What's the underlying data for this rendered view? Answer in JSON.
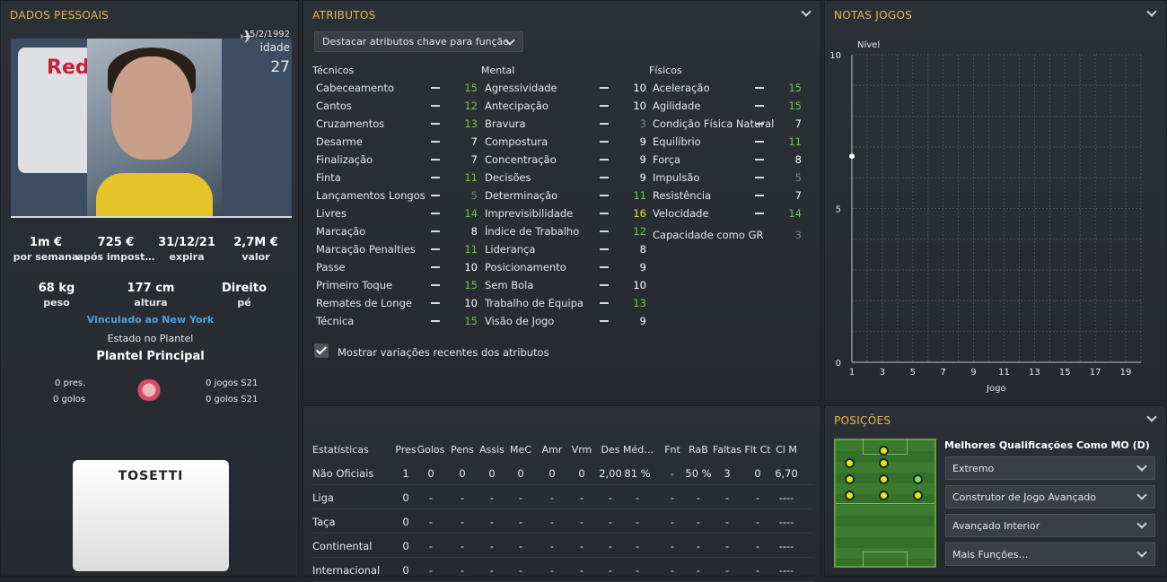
{
  "personal": {
    "title": "DADOS PESSOAIS",
    "dob": "15/2/1992",
    "age_label": "idade",
    "age": "27",
    "club_logo_text": "Red",
    "stats1": [
      {
        "value": "1m €",
        "label": "por semana"
      },
      {
        "value": "725 €",
        "label": "após impost…"
      },
      {
        "value": "31/12/21",
        "label": "expira"
      },
      {
        "value": "2,7M €",
        "label": "valor"
      }
    ],
    "stats2": [
      {
        "value": "68 kg",
        "label": "peso"
      },
      {
        "value": "177 cm",
        "label": "altura"
      },
      {
        "value": "Direito",
        "label": "pé"
      }
    ],
    "contract_link": "Vinculado ao New York",
    "squad_status_label": "Estado no Plantel",
    "squad_status": "Plantel Principal",
    "apps": "0 pres.",
    "goals": "0 golos",
    "apps_season": "0 jogos S21",
    "goals_season": "0 golos S21",
    "shirt_name": "TOSETTI"
  },
  "attributes": {
    "title": "ATRIBUTOS",
    "highlight_dropdown": "Destacar atributos chave para função",
    "technical_header": "Técnicos",
    "mental_header": "Mental",
    "physical_header": "Físicos",
    "technical": [
      {
        "name": "Cabeceamento",
        "value": "15",
        "c": "green"
      },
      {
        "name": "Cantos",
        "value": "12",
        "c": "green"
      },
      {
        "name": "Cruzamentos",
        "value": "13",
        "c": "green"
      },
      {
        "name": "Desarme",
        "value": "7",
        "c": "white"
      },
      {
        "name": "Finalização",
        "value": "7",
        "c": "white"
      },
      {
        "name": "Finta",
        "value": "11",
        "c": "green"
      },
      {
        "name": "Lançamentos Longos",
        "value": "5",
        "c": "gray"
      },
      {
        "name": "Livres",
        "value": "14",
        "c": "green"
      },
      {
        "name": "Marcação",
        "value": "8",
        "c": "white"
      },
      {
        "name": "Marcação Penalties",
        "value": "11",
        "c": "green"
      },
      {
        "name": "Passe",
        "value": "10",
        "c": "white"
      },
      {
        "name": "Primeiro Toque",
        "value": "15",
        "c": "green"
      },
      {
        "name": "Remates de Longe",
        "value": "10",
        "c": "white"
      },
      {
        "name": "Técnica",
        "value": "15",
        "c": "green"
      }
    ],
    "mental": [
      {
        "name": "Agressividade",
        "value": "10",
        "c": "white"
      },
      {
        "name": "Antecipação",
        "value": "10",
        "c": "white"
      },
      {
        "name": "Bravura",
        "value": "3",
        "c": "gray"
      },
      {
        "name": "Compostura",
        "value": "9",
        "c": "white"
      },
      {
        "name": "Concentração",
        "value": "9",
        "c": "white"
      },
      {
        "name": "Decisões",
        "value": "9",
        "c": "white"
      },
      {
        "name": "Determinação",
        "value": "11",
        "c": "green"
      },
      {
        "name": "Imprevisibilidade",
        "value": "16",
        "c": "yellow"
      },
      {
        "name": "Índice de Trabalho",
        "value": "12",
        "c": "green"
      },
      {
        "name": "Liderança",
        "value": "8",
        "c": "white"
      },
      {
        "name": "Posicionamento",
        "value": "9",
        "c": "white"
      },
      {
        "name": "Sem Bola",
        "value": "10",
        "c": "white"
      },
      {
        "name": "Trabalho de Equipa",
        "value": "13",
        "c": "green"
      },
      {
        "name": "Visão de Jogo",
        "value": "9",
        "c": "white"
      }
    ],
    "physical": [
      {
        "name": "Aceleração",
        "value": "15",
        "c": "green"
      },
      {
        "name": "Agilidade",
        "value": "15",
        "c": "green"
      },
      {
        "name": "Condição Física Natural",
        "value": "7",
        "c": "white"
      },
      {
        "name": "Equilíbrio",
        "value": "11",
        "c": "green"
      },
      {
        "name": "Força",
        "value": "8",
        "c": "white"
      },
      {
        "name": "Impulsão",
        "value": "5",
        "c": "gray"
      },
      {
        "name": "Resistência",
        "value": "7",
        "c": "white"
      },
      {
        "name": "Velocidade",
        "value": "14",
        "c": "green"
      }
    ],
    "gk_label": "Capacidade como GR",
    "gk_value": "3",
    "show_changes_label": "Mostrar variações recentes dos atributos"
  },
  "notas": {
    "title": "NOTAS JOGOS",
    "y_label": "Nível",
    "x_label": "Jogo",
    "y_ticks": [
      "10",
      "5",
      "0"
    ],
    "x_ticks": [
      "1",
      "3",
      "5",
      "7",
      "9",
      "11",
      "13",
      "15",
      "17",
      "19"
    ]
  },
  "chart_data": {
    "type": "line",
    "title": "NOTAS JOGOS",
    "xlabel": "Jogo",
    "ylabel": "Nível",
    "ylim": [
      0,
      10
    ],
    "xlim": [
      1,
      20
    ],
    "series": [
      {
        "x": [
          1
        ],
        "values": [
          6.7
        ]
      }
    ]
  },
  "stats": {
    "headers": [
      "Estatísticas",
      "Pres",
      "Golos",
      "Pens",
      "Assis",
      "MeC",
      "Amr",
      "Vrm",
      "Des",
      "Méd…",
      "Fnt",
      "RaB",
      "Faltas",
      "Flt Ct",
      "Cl M"
    ],
    "rows": [
      {
        "label": "Não Oficiais",
        "cells": [
          "1",
          "0",
          "0",
          "0",
          "0",
          "0",
          "0",
          "2,00",
          "81 %",
          "-",
          "50 %",
          "3",
          "0",
          "6,70"
        ]
      },
      {
        "label": "Liga",
        "cells": [
          "0",
          "-",
          "-",
          "-",
          "-",
          "-",
          "-",
          "-",
          "-",
          "-",
          "-",
          "-",
          "-",
          "----"
        ]
      },
      {
        "label": "Taça",
        "cells": [
          "0",
          "-",
          "-",
          "-",
          "-",
          "-",
          "-",
          "-",
          "-",
          "-",
          "-",
          "-",
          "-",
          "----"
        ]
      },
      {
        "label": "Continental",
        "cells": [
          "0",
          "-",
          "-",
          "-",
          "-",
          "-",
          "-",
          "-",
          "-",
          "-",
          "-",
          "-",
          "-",
          "----"
        ]
      },
      {
        "label": "Internacional",
        "cells": [
          "0",
          "-",
          "-",
          "-",
          "-",
          "-",
          "-",
          "-",
          "-",
          "-",
          "-",
          "-",
          "-",
          "----"
        ]
      }
    ]
  },
  "positions": {
    "title": "POSIÇÕES",
    "best_label": "Melhores Qualificações Como MO (D)",
    "roles": [
      "Extremo",
      "Construtor de Jogo Avançado",
      "Avançado Interior",
      "Mais Funções…"
    ]
  },
  "colors": {
    "accent": "#e8b74a",
    "green": "#6ccc3a",
    "link": "#4aa3e0",
    "yellow": "#e8e03a"
  }
}
